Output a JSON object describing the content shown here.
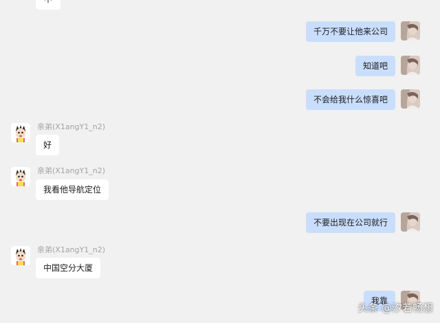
{
  "chat": {
    "partial_top_text": "中",
    "contact_name": "亲弟(X1angY1_n2)",
    "messages": [
      {
        "from": "self",
        "text": "千万不要让他来公司"
      },
      {
        "from": "self",
        "text": "知道吧"
      },
      {
        "from": "self",
        "text": "不会给我什么惊喜吧"
      },
      {
        "from": "contact",
        "text": "好"
      },
      {
        "from": "contact",
        "text": "我看他导航定位"
      },
      {
        "from": "self",
        "text": "不要出现在公司就行"
      },
      {
        "from": "contact",
        "text": "中国空分大厦"
      },
      {
        "from": "self",
        "text": "我靠"
      }
    ]
  },
  "watermark": {
    "platform": "头条",
    "author": "@汐若畅想"
  },
  "colors": {
    "background": "#f1f1f1",
    "outgoing_bubble": "#c9defc",
    "incoming_bubble": "#ffffff"
  }
}
